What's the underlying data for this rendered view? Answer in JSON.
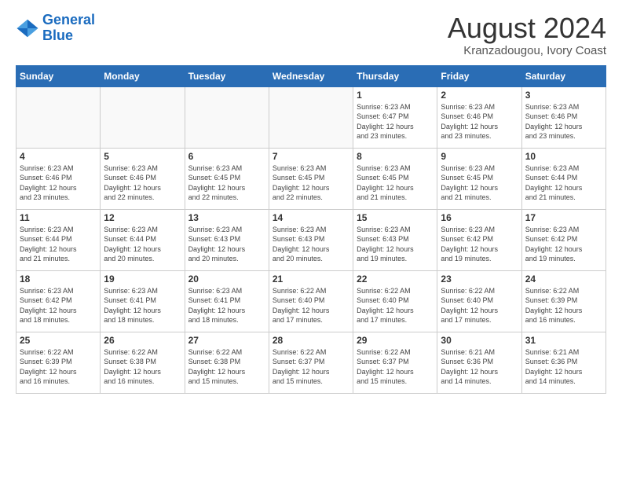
{
  "header": {
    "logo_line1": "General",
    "logo_line2": "Blue",
    "month_title": "August 2024",
    "location": "Kranzadougou, Ivory Coast"
  },
  "days_of_week": [
    "Sunday",
    "Monday",
    "Tuesday",
    "Wednesday",
    "Thursday",
    "Friday",
    "Saturday"
  ],
  "weeks": [
    [
      {
        "day": "",
        "info": ""
      },
      {
        "day": "",
        "info": ""
      },
      {
        "day": "",
        "info": ""
      },
      {
        "day": "",
        "info": ""
      },
      {
        "day": "1",
        "info": "Sunrise: 6:23 AM\nSunset: 6:47 PM\nDaylight: 12 hours\nand 23 minutes."
      },
      {
        "day": "2",
        "info": "Sunrise: 6:23 AM\nSunset: 6:46 PM\nDaylight: 12 hours\nand 23 minutes."
      },
      {
        "day": "3",
        "info": "Sunrise: 6:23 AM\nSunset: 6:46 PM\nDaylight: 12 hours\nand 23 minutes."
      }
    ],
    [
      {
        "day": "4",
        "info": "Sunrise: 6:23 AM\nSunset: 6:46 PM\nDaylight: 12 hours\nand 23 minutes."
      },
      {
        "day": "5",
        "info": "Sunrise: 6:23 AM\nSunset: 6:46 PM\nDaylight: 12 hours\nand 22 minutes."
      },
      {
        "day": "6",
        "info": "Sunrise: 6:23 AM\nSunset: 6:45 PM\nDaylight: 12 hours\nand 22 minutes."
      },
      {
        "day": "7",
        "info": "Sunrise: 6:23 AM\nSunset: 6:45 PM\nDaylight: 12 hours\nand 22 minutes."
      },
      {
        "day": "8",
        "info": "Sunrise: 6:23 AM\nSunset: 6:45 PM\nDaylight: 12 hours\nand 21 minutes."
      },
      {
        "day": "9",
        "info": "Sunrise: 6:23 AM\nSunset: 6:45 PM\nDaylight: 12 hours\nand 21 minutes."
      },
      {
        "day": "10",
        "info": "Sunrise: 6:23 AM\nSunset: 6:44 PM\nDaylight: 12 hours\nand 21 minutes."
      }
    ],
    [
      {
        "day": "11",
        "info": "Sunrise: 6:23 AM\nSunset: 6:44 PM\nDaylight: 12 hours\nand 21 minutes."
      },
      {
        "day": "12",
        "info": "Sunrise: 6:23 AM\nSunset: 6:44 PM\nDaylight: 12 hours\nand 20 minutes."
      },
      {
        "day": "13",
        "info": "Sunrise: 6:23 AM\nSunset: 6:43 PM\nDaylight: 12 hours\nand 20 minutes."
      },
      {
        "day": "14",
        "info": "Sunrise: 6:23 AM\nSunset: 6:43 PM\nDaylight: 12 hours\nand 20 minutes."
      },
      {
        "day": "15",
        "info": "Sunrise: 6:23 AM\nSunset: 6:43 PM\nDaylight: 12 hours\nand 19 minutes."
      },
      {
        "day": "16",
        "info": "Sunrise: 6:23 AM\nSunset: 6:42 PM\nDaylight: 12 hours\nand 19 minutes."
      },
      {
        "day": "17",
        "info": "Sunrise: 6:23 AM\nSunset: 6:42 PM\nDaylight: 12 hours\nand 19 minutes."
      }
    ],
    [
      {
        "day": "18",
        "info": "Sunrise: 6:23 AM\nSunset: 6:42 PM\nDaylight: 12 hours\nand 18 minutes."
      },
      {
        "day": "19",
        "info": "Sunrise: 6:23 AM\nSunset: 6:41 PM\nDaylight: 12 hours\nand 18 minutes."
      },
      {
        "day": "20",
        "info": "Sunrise: 6:23 AM\nSunset: 6:41 PM\nDaylight: 12 hours\nand 18 minutes."
      },
      {
        "day": "21",
        "info": "Sunrise: 6:22 AM\nSunset: 6:40 PM\nDaylight: 12 hours\nand 17 minutes."
      },
      {
        "day": "22",
        "info": "Sunrise: 6:22 AM\nSunset: 6:40 PM\nDaylight: 12 hours\nand 17 minutes."
      },
      {
        "day": "23",
        "info": "Sunrise: 6:22 AM\nSunset: 6:40 PM\nDaylight: 12 hours\nand 17 minutes."
      },
      {
        "day": "24",
        "info": "Sunrise: 6:22 AM\nSunset: 6:39 PM\nDaylight: 12 hours\nand 16 minutes."
      }
    ],
    [
      {
        "day": "25",
        "info": "Sunrise: 6:22 AM\nSunset: 6:39 PM\nDaylight: 12 hours\nand 16 minutes."
      },
      {
        "day": "26",
        "info": "Sunrise: 6:22 AM\nSunset: 6:38 PM\nDaylight: 12 hours\nand 16 minutes."
      },
      {
        "day": "27",
        "info": "Sunrise: 6:22 AM\nSunset: 6:38 PM\nDaylight: 12 hours\nand 15 minutes."
      },
      {
        "day": "28",
        "info": "Sunrise: 6:22 AM\nSunset: 6:37 PM\nDaylight: 12 hours\nand 15 minutes."
      },
      {
        "day": "29",
        "info": "Sunrise: 6:22 AM\nSunset: 6:37 PM\nDaylight: 12 hours\nand 15 minutes."
      },
      {
        "day": "30",
        "info": "Sunrise: 6:21 AM\nSunset: 6:36 PM\nDaylight: 12 hours\nand 14 minutes."
      },
      {
        "day": "31",
        "info": "Sunrise: 6:21 AM\nSunset: 6:36 PM\nDaylight: 12 hours\nand 14 minutes."
      }
    ]
  ]
}
